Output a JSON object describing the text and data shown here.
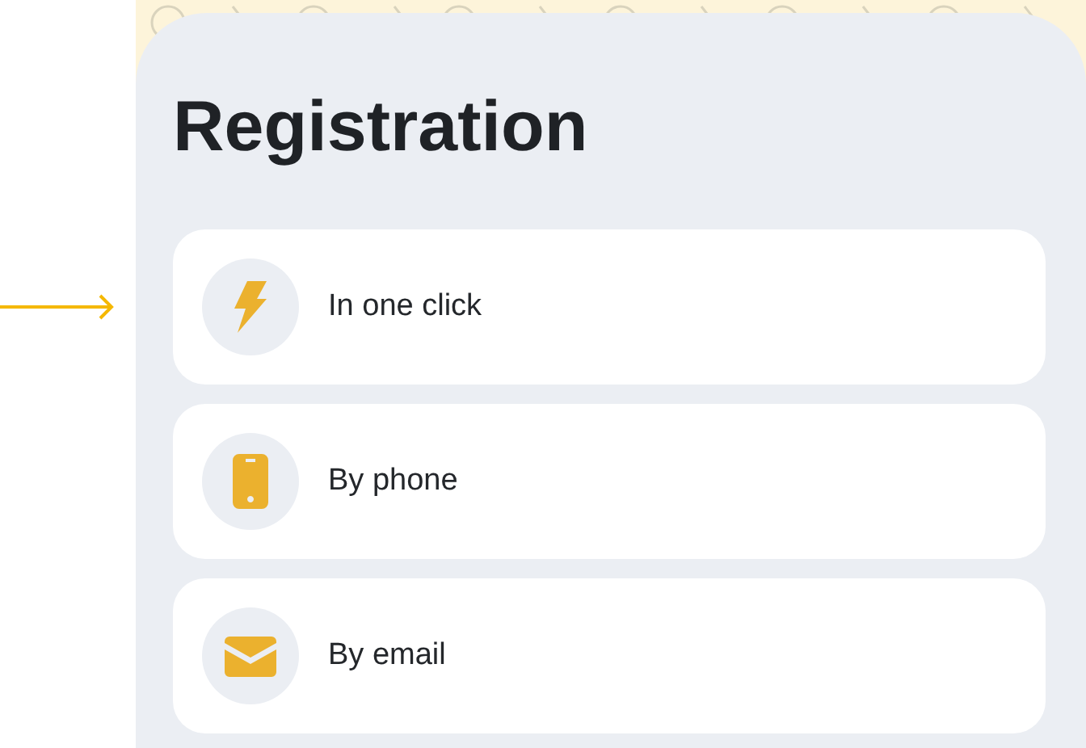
{
  "title": "Registration",
  "options": [
    {
      "kind": "bolt",
      "label": "In one click",
      "highlighted": true
    },
    {
      "kind": "phone",
      "label": "By phone",
      "highlighted": false
    },
    {
      "kind": "mail",
      "label": "By email",
      "highlighted": false
    }
  ]
}
